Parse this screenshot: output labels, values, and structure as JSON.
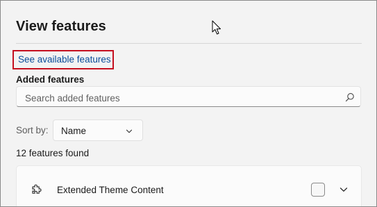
{
  "page": {
    "title": "View features",
    "see_available_link": "See available features",
    "added_features_label": "Added features"
  },
  "search": {
    "placeholder": "Search added features",
    "value": "",
    "icon": "search-icon"
  },
  "sort": {
    "label": "Sort by:",
    "selected": "Name",
    "icon": "chevron-down-icon"
  },
  "results": {
    "count_text": "12 features found"
  },
  "features": [
    {
      "name": "Extended Theme Content",
      "icon": "puzzle-icon",
      "checked": false
    }
  ],
  "colors": {
    "background": "#f3f3f3",
    "link": "#0a4c9a",
    "highlight_box": "#c50f1f"
  }
}
